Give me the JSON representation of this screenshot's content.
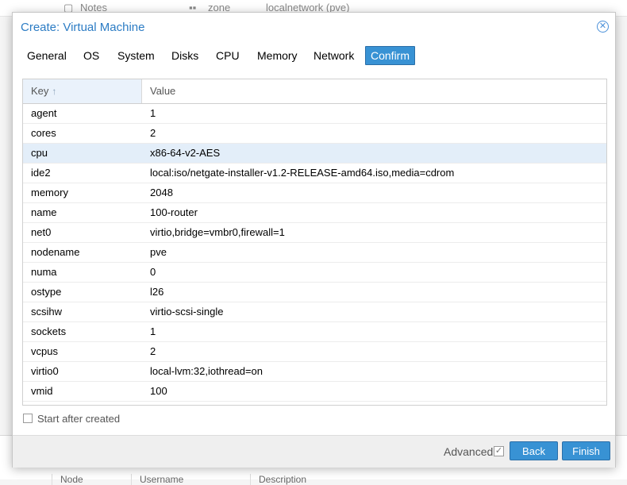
{
  "background": {
    "notes_label": "Notes",
    "zone_label": "zone",
    "zone_value": "localnetwork (pve)",
    "bottom_cols": [
      "Node",
      "Username",
      "Description"
    ]
  },
  "dialog": {
    "title": "Create: Virtual Machine",
    "close_icon": "close-circle-icon",
    "tabs": [
      {
        "label": "General",
        "active": false
      },
      {
        "label": "OS",
        "active": false
      },
      {
        "label": "System",
        "active": false
      },
      {
        "label": "Disks",
        "active": false
      },
      {
        "label": "CPU",
        "active": false
      },
      {
        "label": "Memory",
        "active": false
      },
      {
        "label": "Network",
        "active": false
      },
      {
        "label": "Confirm",
        "active": true
      }
    ],
    "grid": {
      "columns": {
        "key": "Key",
        "key_sort": "↑",
        "value": "Value"
      },
      "rows": [
        {
          "key": "agent",
          "value": "1"
        },
        {
          "key": "cores",
          "value": "2"
        },
        {
          "key": "cpu",
          "value": "x86-64-v2-AES",
          "selected": true
        },
        {
          "key": "ide2",
          "value": "local:iso/netgate-installer-v1.2-RELEASE-amd64.iso,media=cdrom"
        },
        {
          "key": "memory",
          "value": "2048"
        },
        {
          "key": "name",
          "value": "100-router"
        },
        {
          "key": "net0",
          "value": "virtio,bridge=vmbr0,firewall=1"
        },
        {
          "key": "nodename",
          "value": "pve"
        },
        {
          "key": "numa",
          "value": "0"
        },
        {
          "key": "ostype",
          "value": "l26"
        },
        {
          "key": "scsihw",
          "value": "virtio-scsi-single"
        },
        {
          "key": "sockets",
          "value": "1"
        },
        {
          "key": "vcpus",
          "value": "2"
        },
        {
          "key": "virtio0",
          "value": "local-lvm:32,iothread=on"
        },
        {
          "key": "vmid",
          "value": "100"
        }
      ]
    },
    "start_after_created": {
      "label": "Start after created",
      "checked": false
    },
    "footer": {
      "advanced_label": "Advanced",
      "advanced_checked": true,
      "back_label": "Back",
      "finish_label": "Finish"
    },
    "colors": {
      "accent": "#3892d4",
      "title": "#2c7cc4",
      "selected_row": "#e3eef9"
    }
  }
}
